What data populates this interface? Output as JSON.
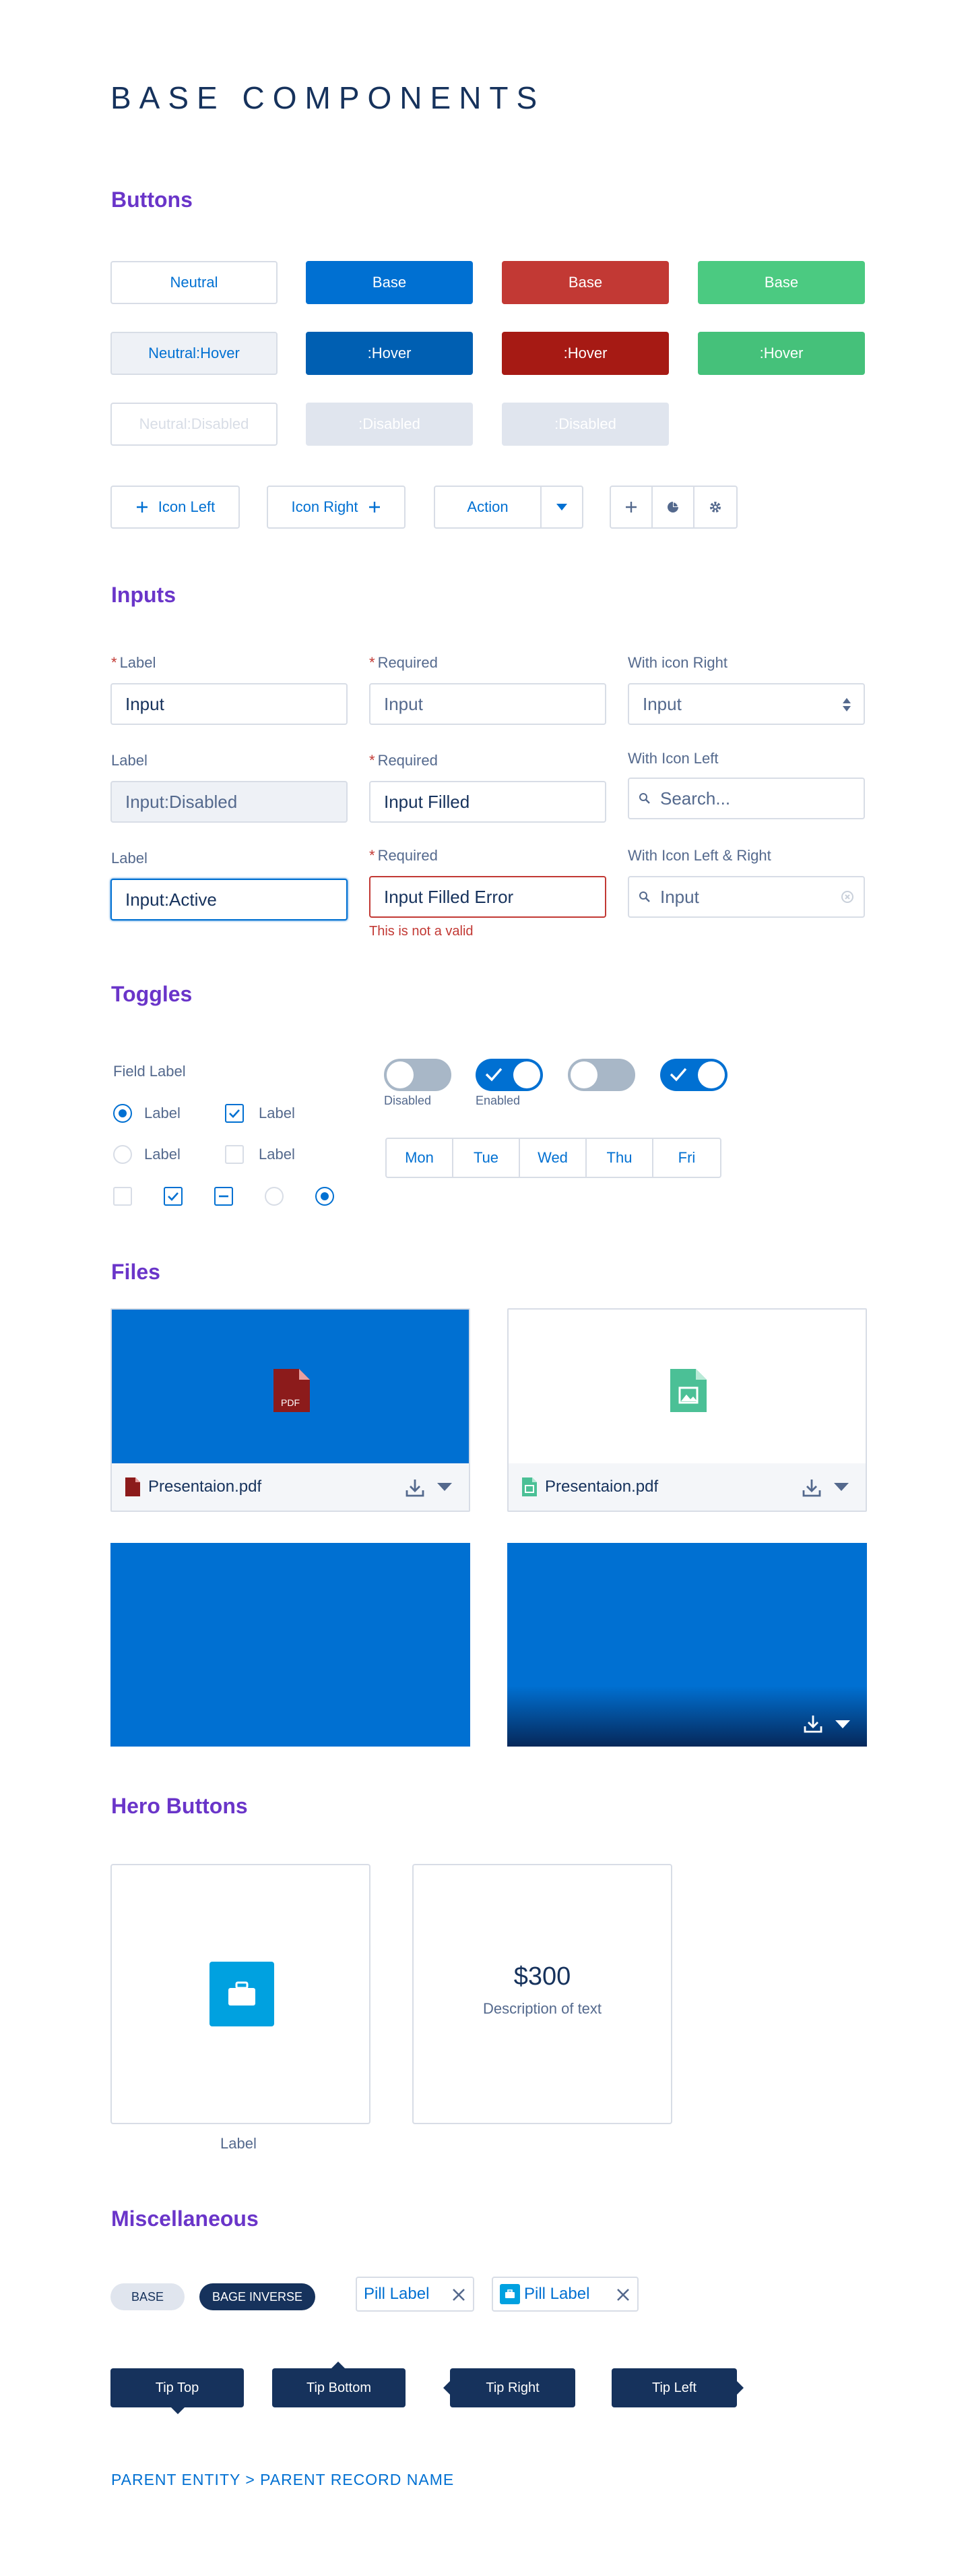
{
  "page": {
    "title": "BASE COMPONENTS"
  },
  "sections": {
    "buttons": "Buttons",
    "inputs": "Inputs",
    "toggles": "Toggles",
    "files": "Files",
    "hero": "Hero Buttons",
    "misc": "Miscellaneous"
  },
  "buttons": {
    "row1": [
      "Neutral",
      "Base",
      "Base",
      "Base"
    ],
    "row2": [
      "Neutral:Hover",
      ":Hover",
      ":Hover",
      ":Hover"
    ],
    "row3": [
      "Neutral:Disabled",
      ":Disabled",
      ":Disabled"
    ],
    "icon_left": "Icon Left",
    "icon_right": "Icon Right",
    "action": "Action"
  },
  "inputs": {
    "r1c1_label": "Label",
    "r1c1_value": "Input",
    "r1c2_label": "Required",
    "r1c2_placeholder": "Input",
    "r1c3_label": "With icon Right",
    "r1c3_value": "Input",
    "r2c1_label": "Label",
    "r2c1_value": "Input:Disabled",
    "r2c2_label": "Required",
    "r2c2_value": "Input Filled",
    "r2c3_label": "With Icon Left",
    "r2c3_placeholder": "Search...",
    "r3c1_label": "Label",
    "r3c1_value": "Input:Active",
    "r3c2_label": "Required",
    "r3c2_value": "Input Filled Error",
    "r3c2_error": "This is not a valid",
    "r3c3_label": "With Icon Left & Right",
    "r3c3_placeholder": "Input"
  },
  "toggles": {
    "field_label": "Field Label",
    "option_label": "Label",
    "toggle_disabled": "Disabled",
    "toggle_enabled": "Enabled",
    "days": [
      "Mon",
      "Tue",
      "Wed",
      "Thu",
      "Fri"
    ]
  },
  "files": {
    "name1": "Presentaion.pdf",
    "name2": "Presentaion.pdf",
    "pdf_tag": "PDF"
  },
  "hero": {
    "label": "Label",
    "price": "$300",
    "description": "Description of text"
  },
  "misc": {
    "badge": "BASE",
    "badge_inverse": "BAGE INVERSE",
    "pill1": "Pill Label",
    "pill2": "Pill Label",
    "tips": [
      "Tip Top",
      "Tip Bottom",
      "Tip Right",
      "Tip Left"
    ],
    "breadcrumb": "PARENT ENTITY > PARENT RECORD NAME"
  },
  "colors": {
    "brand": "#0070d2",
    "destructive": "#c23934",
    "success": "#4bca81",
    "heading": "#6a35c9",
    "navy": "#16325c"
  }
}
